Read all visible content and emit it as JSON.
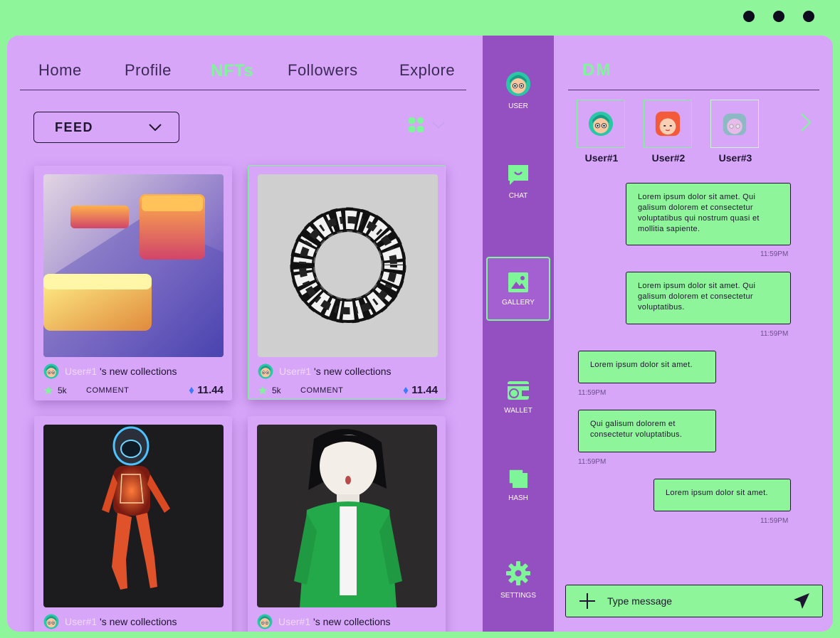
{
  "nav": {
    "items": [
      "Home",
      "Profile",
      "NFTs",
      "Followers",
      "Explore"
    ],
    "active": "NFTs"
  },
  "feed": {
    "select_label": "FEED"
  },
  "cards": [
    {
      "user": "User#1",
      "caption": "'s new collections",
      "likes": "5k",
      "comment_label": "COMMENT",
      "price": "11.44"
    },
    {
      "user": "User#1",
      "caption": "'s new collections",
      "likes": "5k",
      "comment_label": "COMMENT",
      "price": "11.44"
    },
    {
      "user": "User#1",
      "caption": "'s new collections"
    },
    {
      "user": "User#1",
      "caption": "'s new collections"
    }
  ],
  "sidebar": {
    "items": [
      "USER",
      "CHAT",
      "GALLERY",
      "WALLET",
      "HASH",
      "SETTINGS"
    ],
    "active": "GALLERY"
  },
  "dm": {
    "title": "DM",
    "contacts": [
      "User#1",
      "User#2",
      "User#3"
    ],
    "messages": [
      {
        "text": "Lorem ipsum dolor sit amet. Qui galisum dolorem et consectetur voluptatibus qui nostrum quasi et mollitia sapiente.",
        "time": "11:59PM",
        "side": "right"
      },
      {
        "text": "Lorem ipsum dolor sit amet. Qui galisum dolorem et consectetur voluptatibus.",
        "time": "11:59PM",
        "side": "right"
      },
      {
        "text": "Lorem ipsum dolor sit amet.",
        "time": "11:59PM",
        "side": "left"
      },
      {
        "text": "Qui galisum dolorem et consectetur voluptatibus.",
        "time": "11:59PM",
        "side": "left"
      },
      {
        "text": "Lorem ipsum dolor sit amet.",
        "time": "11:59PM",
        "side": "right"
      }
    ],
    "composer_placeholder": "Type message"
  },
  "colors": {
    "accent": "#7ff59a",
    "panel": "#d8a6f9",
    "sidebar": "#944fc0",
    "ink": "#1e1530"
  }
}
